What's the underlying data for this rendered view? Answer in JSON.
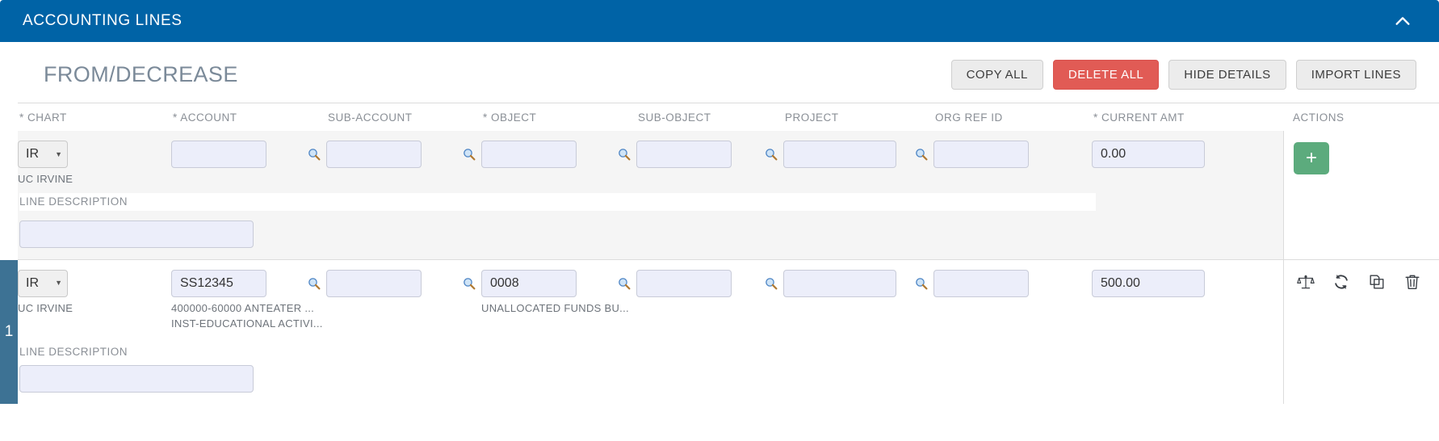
{
  "panel": {
    "title": "ACCOUNTING LINES",
    "collapse_icon": "chevron-up-icon",
    "header_color": "#0063a6"
  },
  "section": {
    "title": "FROM/DECREASE",
    "buttons": [
      {
        "label": "COPY ALL",
        "style": "default"
      },
      {
        "label": "DELETE ALL",
        "style": "danger",
        "color": "#e15b55"
      },
      {
        "label": "HIDE DETAILS",
        "style": "default"
      },
      {
        "label": "IMPORT LINES",
        "style": "default"
      }
    ]
  },
  "table": {
    "headers": {
      "chart": "* CHART",
      "account": "* ACCOUNT",
      "sub_account": "SUB-ACCOUNT",
      "object": "* OBJECT",
      "sub_object": "SUB-OBJECT",
      "project": "PROJECT",
      "org_ref_id": "ORG REF ID",
      "current_amt": "* CURRENT AMT",
      "actions": "ACTIONS"
    },
    "line_description_label": "LINE DESCRIPTION",
    "lookup_icon": "magnifier-lookup-icon",
    "new_row": {
      "chart_value": "IR",
      "chart_sublabel": "UC IRVINE",
      "account_value": "",
      "sub_account_value": "",
      "object_value": "",
      "sub_object_value": "",
      "project_value": "",
      "org_ref_id_value": "",
      "current_amt_value": "0.00",
      "line_description_value": "",
      "add_button_label": "+",
      "add_button_color": "#5cab7d"
    },
    "rows": [
      {
        "number": "1",
        "chart_value": "IR",
        "chart_sublabel": "UC IRVINE",
        "account_value": "SS12345",
        "account_sublabel_1": "400000-60000 ANTEATER ...",
        "account_sublabel_2": "INST-EDUCATIONAL ACTIVI...",
        "sub_account_value": "",
        "object_value": "0008",
        "object_sublabel": "UNALLOCATED FUNDS BU...",
        "sub_object_value": "",
        "project_value": "",
        "org_ref_id_value": "",
        "current_amt_value": "500.00",
        "line_description_value": "",
        "actions": [
          {
            "name": "balance-scale-icon",
            "title": "Balance"
          },
          {
            "name": "refresh-icon",
            "title": "Refresh"
          },
          {
            "name": "copy-icon",
            "title": "Copy"
          },
          {
            "name": "trash-icon",
            "title": "Delete"
          }
        ]
      }
    ]
  }
}
